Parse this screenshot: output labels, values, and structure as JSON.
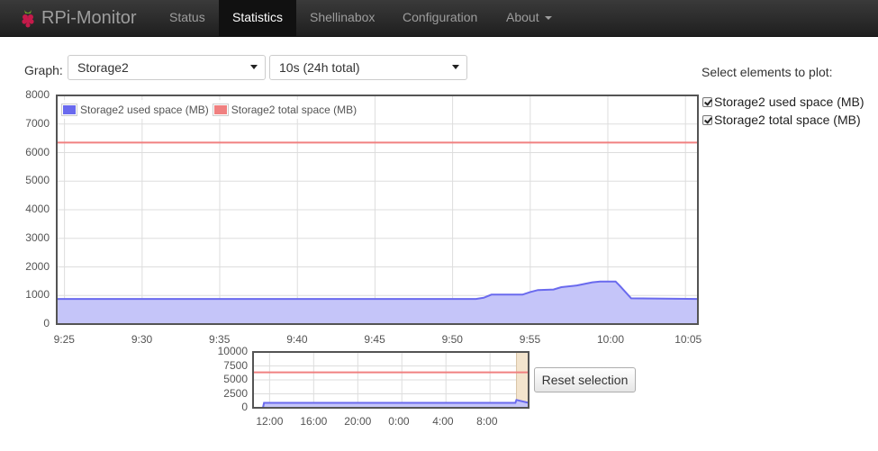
{
  "navbar": {
    "brand": "RPi-Monitor",
    "items": [
      {
        "label": "Status"
      },
      {
        "label": "Statistics"
      },
      {
        "label": "Shellinabox"
      },
      {
        "label": "Configuration"
      },
      {
        "label": "About"
      }
    ],
    "active": "Statistics"
  },
  "controls": {
    "graph_label": "Graph:",
    "graph_select": "Storage2",
    "range_select": "10s (24h total)",
    "plot_title": "Select elements to plot:",
    "checkboxes": [
      {
        "label": "Storage2 used space (MB)",
        "checked": true
      },
      {
        "label": "Storage2 total space (MB)",
        "checked": true
      }
    ],
    "reset_label": "Reset selection"
  },
  "colors": {
    "used_line": "#6a6aee",
    "used_fill": "#c5c5f9",
    "total_line": "#f08080",
    "selection_fill": "#f3e4cd"
  },
  "chart_data": [
    {
      "type": "area",
      "legend": [
        "Storage2 used space (MB)",
        "Storage2 total space (MB)"
      ],
      "legend_position": "top-left",
      "grid": true,
      "ylim": [
        0,
        8000
      ],
      "yticks": [
        "0",
        "1000",
        "2000",
        "3000",
        "4000",
        "5000",
        "6000",
        "7000",
        "8000"
      ],
      "xticks": [
        "9:25",
        "9:30",
        "9:35",
        "9:40",
        "9:45",
        "9:50",
        "9:55",
        "10:00",
        "10:05"
      ],
      "xlim_min": [
        -0.5,
        40.8
      ],
      "series": [
        {
          "name": "Storage2 used space (MB)",
          "x_min": [
            -0.5,
            26.5,
            27,
            27.5,
            29.5,
            30,
            30.5,
            31.5,
            32,
            33,
            34,
            34.5,
            35.5,
            35.8,
            36.5,
            40.8
          ],
          "values": [
            880,
            880,
            920,
            1030,
            1030,
            1120,
            1190,
            1210,
            1290,
            1350,
            1460,
            1490,
            1490,
            1320,
            900,
            880
          ]
        },
        {
          "name": "Storage2 total space (MB)",
          "x_min": [
            -0.5,
            40.8
          ],
          "values": [
            6350,
            6350
          ]
        }
      ]
    },
    {
      "type": "area",
      "overview": true,
      "ylim": [
        0,
        10000
      ],
      "yticks": [
        "0",
        "2500",
        "5000",
        "7500",
        "10000"
      ],
      "xticks": [
        "12:00",
        "16:00",
        "20:00",
        "0:00",
        "4:00",
        "8:00"
      ],
      "x_hours": [
        10.5,
        35.5
      ],
      "series": [
        {
          "name": "Storage2 used space (MB)",
          "x_hours": [
            10.5,
            11.4,
            11.5,
            34.3,
            34.4,
            35.5
          ],
          "values": [
            0,
            0,
            880,
            880,
            1400,
            880
          ]
        },
        {
          "name": "Storage2 total space (MB)",
          "x_hours": [
            10.5,
            35.5
          ],
          "values": [
            6350,
            6350
          ]
        }
      ],
      "selection_hours": [
        34.4,
        35.5
      ]
    }
  ]
}
